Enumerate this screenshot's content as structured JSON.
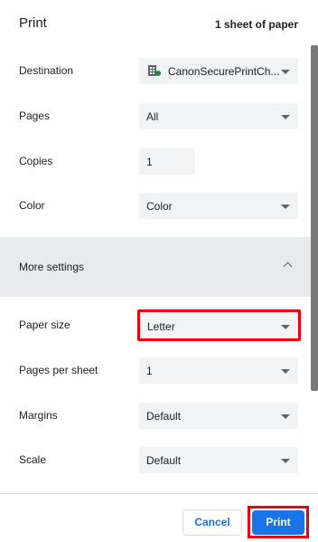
{
  "header": {
    "title": "Print",
    "sheets": "1 sheet of paper"
  },
  "rows": {
    "destination": {
      "label": "Destination",
      "value": "CanonSecurePrintCh...",
      "icon": "printer-cloud-icon"
    },
    "pages": {
      "label": "Pages",
      "value": "All"
    },
    "copies": {
      "label": "Copies",
      "value": "1"
    },
    "color": {
      "label": "Color",
      "value": "Color"
    }
  },
  "more_settings": {
    "label": "More settings",
    "expanded": true
  },
  "advanced": {
    "paper_size": {
      "label": "Paper size",
      "value": "Letter"
    },
    "pages_per_sheet": {
      "label": "Pages per sheet",
      "value": "1"
    },
    "margins": {
      "label": "Margins",
      "value": "Default"
    },
    "scale": {
      "label": "Scale",
      "value": "Default"
    }
  },
  "buttons": {
    "cancel": "Cancel",
    "print": "Print"
  },
  "colors": {
    "accent": "#1a73e8",
    "highlight": "#e8000f",
    "field_bg": "#f1f3f4"
  }
}
